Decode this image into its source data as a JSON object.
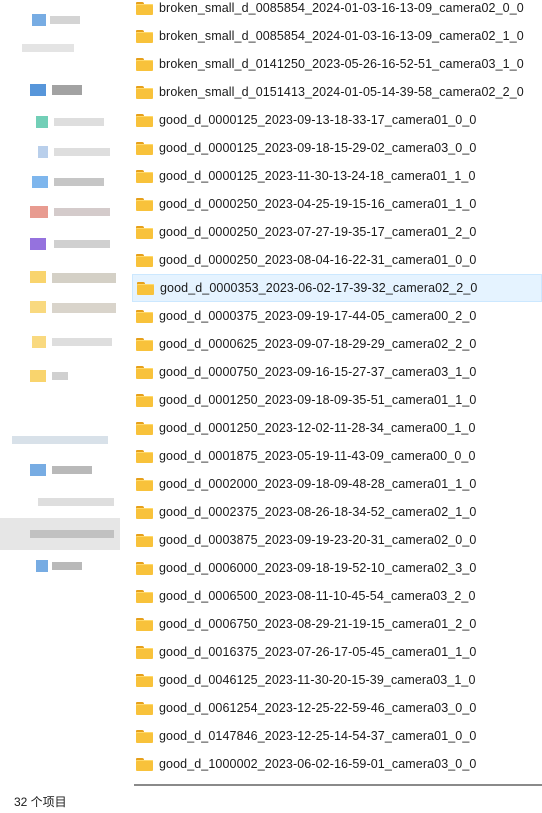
{
  "file_list": {
    "items": [
      {
        "name": "broken_small_d_0085854_2024-01-03-16-13-09_camera02_0_0",
        "icon": "folder-icon"
      },
      {
        "name": "broken_small_d_0085854_2024-01-03-16-13-09_camera02_1_0",
        "icon": "folder-icon"
      },
      {
        "name": "broken_small_d_0141250_2023-05-26-16-52-51_camera03_1_0",
        "icon": "folder-icon"
      },
      {
        "name": "broken_small_d_0151413_2024-01-05-14-39-58_camera02_2_0",
        "icon": "folder-icon"
      },
      {
        "name": "good_d_0000125_2023-09-13-18-33-17_camera01_0_0",
        "icon": "folder-icon"
      },
      {
        "name": "good_d_0000125_2023-09-18-15-29-02_camera03_0_0",
        "icon": "folder-icon"
      },
      {
        "name": "good_d_0000125_2023-11-30-13-24-18_camera01_1_0",
        "icon": "folder-icon"
      },
      {
        "name": "good_d_0000250_2023-04-25-19-15-16_camera01_1_0",
        "icon": "folder-icon"
      },
      {
        "name": "good_d_0000250_2023-07-27-19-35-17_camera01_2_0",
        "icon": "folder-icon"
      },
      {
        "name": "good_d_0000250_2023-08-04-16-22-31_camera01_0_0",
        "icon": "folder-icon"
      },
      {
        "name": "good_d_0000353_2023-06-02-17-39-32_camera02_2_0",
        "icon": "folder-icon"
      },
      {
        "name": "good_d_0000375_2023-09-19-17-44-05_camera00_2_0",
        "icon": "folder-icon"
      },
      {
        "name": "good_d_0000625_2023-09-07-18-29-29_camera02_2_0",
        "icon": "folder-icon"
      },
      {
        "name": "good_d_0000750_2023-09-16-15-27-37_camera03_1_0",
        "icon": "folder-icon"
      },
      {
        "name": "good_d_0001250_2023-09-18-09-35-51_camera01_1_0",
        "icon": "folder-icon"
      },
      {
        "name": "good_d_0001250_2023-12-02-11-28-34_camera00_1_0",
        "icon": "folder-icon"
      },
      {
        "name": "good_d_0001875_2023-05-19-11-43-09_camera00_0_0",
        "icon": "folder-icon"
      },
      {
        "name": "good_d_0002000_2023-09-18-09-48-28_camera01_1_0",
        "icon": "folder-icon"
      },
      {
        "name": "good_d_0002375_2023-08-26-18-34-52_camera02_1_0",
        "icon": "folder-icon"
      },
      {
        "name": "good_d_0003875_2023-09-19-23-20-31_camera02_0_0",
        "icon": "folder-icon"
      },
      {
        "name": "good_d_0006000_2023-09-18-19-52-10_camera02_3_0",
        "icon": "folder-icon"
      },
      {
        "name": "good_d_0006500_2023-08-11-10-45-54_camera03_2_0",
        "icon": "folder-icon"
      },
      {
        "name": "good_d_0006750_2023-08-29-21-19-15_camera01_2_0",
        "icon": "folder-icon"
      },
      {
        "name": "good_d_0016375_2023-07-26-17-05-45_camera01_1_0",
        "icon": "folder-icon"
      },
      {
        "name": "good_d_0046125_2023-11-30-20-15-39_camera03_1_0",
        "icon": "folder-icon"
      },
      {
        "name": "good_d_0061254_2023-12-25-22-59-46_camera03_0_0",
        "icon": "folder-icon"
      },
      {
        "name": "good_d_0147846_2023-12-25-14-54-37_camera01_0_0",
        "icon": "folder-icon"
      },
      {
        "name": "good_d_1000002_2023-06-02-16-59-01_camera03_0_0",
        "icon": "folder-icon"
      }
    ],
    "hovered_item": "good_d_0000353_2023-06-02-17-39-32_camera02_2_0"
  },
  "status_bar": {
    "item_count": "32 个项目"
  },
  "colors": {
    "folder": "#f8c23b",
    "folder_tab": "#e6a01a",
    "hover_bg": "#e5f3ff",
    "nav_selected_bg": "#e6e6e6"
  }
}
